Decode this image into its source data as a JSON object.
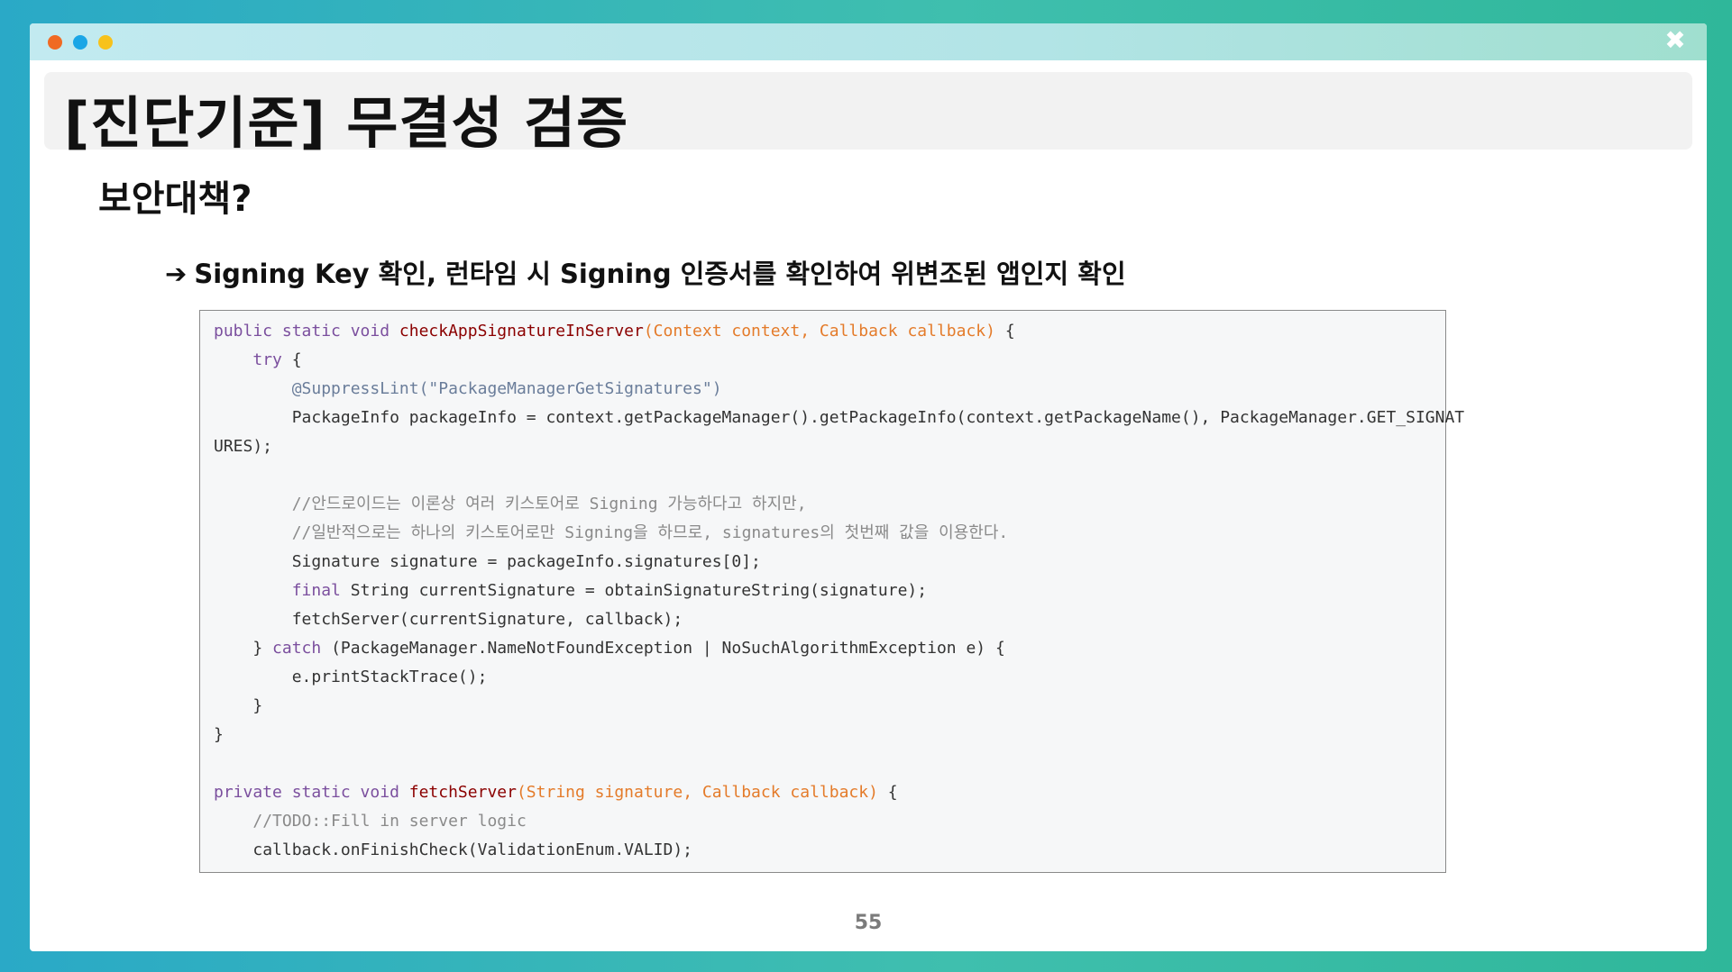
{
  "window": {
    "close_glyph": "✖"
  },
  "slide": {
    "title": "[진단기준] 무결성 검증",
    "subtitle": "보안대책?",
    "bullet_arrow": "➔",
    "bullet_text": "Signing Key 확인, 런타임 시 Signing 인증서를 확인하여 위변조된 앱인지 확인",
    "page_number": "55"
  },
  "code": {
    "lines": [
      {
        "indent": "",
        "parts": [
          [
            "kw",
            "public static void "
          ],
          [
            "fn",
            "checkAppSignatureInServer"
          ],
          [
            "param",
            "(Context context, Callback callback)"
          ],
          [
            "plain",
            " {"
          ]
        ]
      },
      {
        "indent": "    ",
        "parts": [
          [
            "kw",
            "try"
          ],
          [
            "plain",
            " {"
          ]
        ]
      },
      {
        "indent": "        ",
        "parts": [
          [
            "anno",
            "@SuppressLint(\"PackageManagerGetSignatures\")"
          ]
        ]
      },
      {
        "indent": "        ",
        "parts": [
          [
            "plain",
            "PackageInfo packageInfo = context.getPackageManager().getPackageInfo(context.getPackageName(), PackageManager.GET_SIGNAT"
          ]
        ]
      },
      {
        "indent": "",
        "parts": [
          [
            "plain",
            "URES);"
          ]
        ]
      },
      {
        "indent": "",
        "parts": [
          [
            "plain",
            ""
          ]
        ]
      },
      {
        "indent": "        ",
        "parts": [
          [
            "cm",
            "//안드로이드는 이론상 여러 키스토어로 Signing 가능하다고 하지만,"
          ]
        ]
      },
      {
        "indent": "        ",
        "parts": [
          [
            "cm",
            "//일반적으로는 하나의 키스토어로만 Signing을 하므로, signatures의 첫번째 값을 이용한다."
          ]
        ]
      },
      {
        "indent": "        ",
        "parts": [
          [
            "plain",
            "Signature signature = packageInfo.signatures[0];"
          ]
        ]
      },
      {
        "indent": "        ",
        "parts": [
          [
            "kw",
            "final"
          ],
          [
            "plain",
            " String currentSignature = obtainSignatureString(signature);"
          ]
        ]
      },
      {
        "indent": "        ",
        "parts": [
          [
            "plain",
            "fetchServer(currentSignature, callback);"
          ]
        ]
      },
      {
        "indent": "    ",
        "parts": [
          [
            "plain",
            "} "
          ],
          [
            "kw",
            "catch"
          ],
          [
            "plain",
            " (PackageManager.NameNotFoundException | NoSuchAlgorithmException e) {"
          ]
        ]
      },
      {
        "indent": "        ",
        "parts": [
          [
            "plain",
            "e.printStackTrace();"
          ]
        ]
      },
      {
        "indent": "    ",
        "parts": [
          [
            "plain",
            "}"
          ]
        ]
      },
      {
        "indent": "",
        "parts": [
          [
            "plain",
            "}"
          ]
        ]
      },
      {
        "indent": "",
        "parts": [
          [
            "plain",
            ""
          ]
        ]
      },
      {
        "indent": "",
        "parts": [
          [
            "kw",
            "private static void "
          ],
          [
            "fn",
            "fetchServer"
          ],
          [
            "param",
            "(String signature, Callback callback)"
          ],
          [
            "plain",
            " {"
          ]
        ]
      },
      {
        "indent": "    ",
        "parts": [
          [
            "cm",
            "//TODO::Fill in server logic"
          ]
        ]
      },
      {
        "indent": "    ",
        "parts": [
          [
            "plain",
            "callback.onFinishCheck(ValidationEnum.VALID);"
          ]
        ]
      }
    ]
  },
  "colors": {
    "keyword": "#7b4f9e",
    "method": "#8b0000",
    "params": "#e47b2a",
    "comment": "#8a8a8a"
  }
}
